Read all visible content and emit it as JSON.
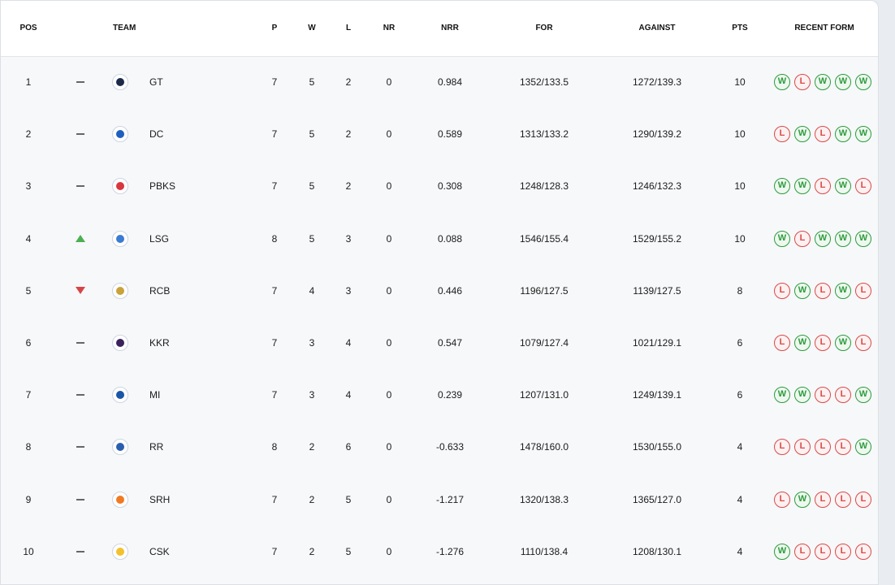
{
  "headers": {
    "pos": "POS",
    "team": "TEAM",
    "p": "P",
    "w": "W",
    "l": "L",
    "nr": "NR",
    "nrr": "NRR",
    "for": "FOR",
    "against": "AGAINST",
    "pts": "PTS",
    "form": "RECENT FORM"
  },
  "colors": {
    "win": "#2e9b3e",
    "loss": "#d84a4a",
    "up": "#4caf50",
    "down": "#d64545"
  },
  "rows": [
    {
      "pos": "1",
      "movement": "same",
      "team": "GT",
      "logo": "gt-logo-icon",
      "logo_color": "#1c2a4a",
      "p": "7",
      "w": "5",
      "l": "2",
      "nr": "0",
      "nrr": "0.984",
      "for": "1352/133.5",
      "against": "1272/139.3",
      "pts": "10",
      "form": [
        "W",
        "L",
        "W",
        "W",
        "W"
      ]
    },
    {
      "pos": "2",
      "movement": "same",
      "team": "DC",
      "logo": "dc-logo-icon",
      "logo_color": "#1f5fbf",
      "p": "7",
      "w": "5",
      "l": "2",
      "nr": "0",
      "nrr": "0.589",
      "for": "1313/133.2",
      "against": "1290/139.2",
      "pts": "10",
      "form": [
        "L",
        "W",
        "L",
        "W",
        "W"
      ]
    },
    {
      "pos": "3",
      "movement": "same",
      "team": "PBKS",
      "logo": "pbks-logo-icon",
      "logo_color": "#d9363e",
      "p": "7",
      "w": "5",
      "l": "2",
      "nr": "0",
      "nrr": "0.308",
      "for": "1248/128.3",
      "against": "1246/132.3",
      "pts": "10",
      "form": [
        "W",
        "W",
        "L",
        "W",
        "L"
      ]
    },
    {
      "pos": "4",
      "movement": "up",
      "team": "LSG",
      "logo": "lsg-logo-icon",
      "logo_color": "#3b7bd4",
      "p": "8",
      "w": "5",
      "l": "3",
      "nr": "0",
      "nrr": "0.088",
      "for": "1546/155.4",
      "against": "1529/155.2",
      "pts": "10",
      "form": [
        "W",
        "L",
        "W",
        "W",
        "W"
      ]
    },
    {
      "pos": "5",
      "movement": "down",
      "team": "RCB",
      "logo": "rcb-logo-icon",
      "logo_color": "#c9a23a",
      "p": "7",
      "w": "4",
      "l": "3",
      "nr": "0",
      "nrr": "0.446",
      "for": "1196/127.5",
      "against": "1139/127.5",
      "pts": "8",
      "form": [
        "L",
        "W",
        "L",
        "W",
        "L"
      ]
    },
    {
      "pos": "6",
      "movement": "same",
      "team": "KKR",
      "logo": "kkr-logo-icon",
      "logo_color": "#3a225d",
      "p": "7",
      "w": "3",
      "l": "4",
      "nr": "0",
      "nrr": "0.547",
      "for": "1079/127.4",
      "against": "1021/129.1",
      "pts": "6",
      "form": [
        "L",
        "W",
        "L",
        "W",
        "L"
      ]
    },
    {
      "pos": "7",
      "movement": "same",
      "team": "MI",
      "logo": "mi-logo-icon",
      "logo_color": "#1a56a8",
      "p": "7",
      "w": "3",
      "l": "4",
      "nr": "0",
      "nrr": "0.239",
      "for": "1207/131.0",
      "against": "1249/139.1",
      "pts": "6",
      "form": [
        "W",
        "W",
        "L",
        "L",
        "W"
      ]
    },
    {
      "pos": "8",
      "movement": "same",
      "team": "RR",
      "logo": "rr-logo-icon",
      "logo_color": "#2a5fb0",
      "p": "8",
      "w": "2",
      "l": "6",
      "nr": "0",
      "nrr": "-0.633",
      "for": "1478/160.0",
      "against": "1530/155.0",
      "pts": "4",
      "form": [
        "L",
        "L",
        "L",
        "L",
        "W"
      ]
    },
    {
      "pos": "9",
      "movement": "same",
      "team": "SRH",
      "logo": "srh-logo-icon",
      "logo_color": "#f07a22",
      "p": "7",
      "w": "2",
      "l": "5",
      "nr": "0",
      "nrr": "-1.217",
      "for": "1320/138.3",
      "against": "1365/127.0",
      "pts": "4",
      "form": [
        "L",
        "W",
        "L",
        "L",
        "L"
      ]
    },
    {
      "pos": "10",
      "movement": "same",
      "team": "CSK",
      "logo": "csk-logo-icon",
      "logo_color": "#f2c12e",
      "p": "7",
      "w": "2",
      "l": "5",
      "nr": "0",
      "nrr": "-1.276",
      "for": "1110/138.4",
      "against": "1208/130.1",
      "pts": "4",
      "form": [
        "W",
        "L",
        "L",
        "L",
        "L"
      ]
    }
  ]
}
